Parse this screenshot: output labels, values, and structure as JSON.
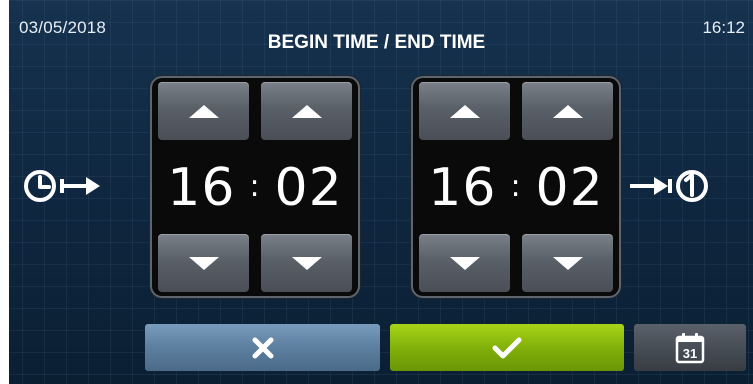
{
  "header": {
    "date": "03/05/2018",
    "time": "16:12",
    "title": "BEGIN TIME / END TIME"
  },
  "begin": {
    "hours": "16",
    "separator": ":",
    "minutes": "02"
  },
  "end": {
    "hours": "16",
    "separator": ":",
    "minutes": "02"
  },
  "footer": {
    "calendar_day": "31"
  },
  "colors": {
    "background": "#0f2a44",
    "cancel": "#5d7f9f",
    "confirm": "#7fae0a",
    "calendar": "#444a52"
  },
  "icons": {
    "begin": "clock-arrow-out-icon",
    "end": "arrow-into-clock-icon",
    "cancel": "close-icon",
    "confirm": "checkmark-icon",
    "calendar": "calendar-icon",
    "increment": "triangle-up-icon",
    "decrement": "triangle-down-icon"
  }
}
